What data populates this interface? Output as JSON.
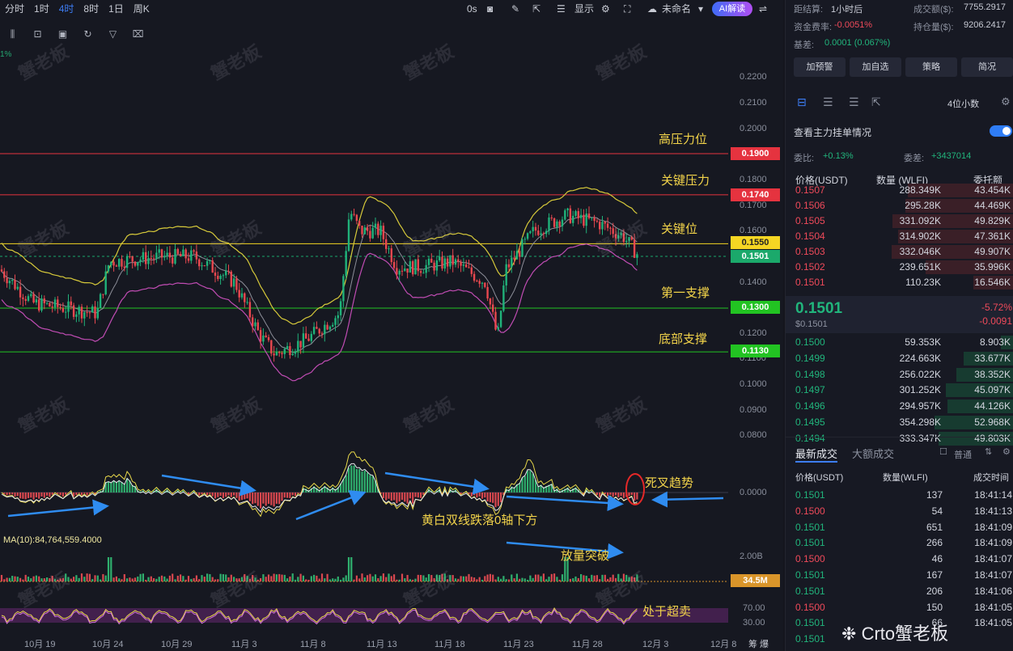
{
  "toolbar": {
    "timeframes": [
      "分时",
      "1时",
      "4时",
      "8时",
      "1日",
      "周K"
    ],
    "active_timeframe": "4时",
    "countdown": "0s",
    "display_label": "显示",
    "layout_name": "未命名",
    "ai_button": "AI解读"
  },
  "chart": {
    "change_hint": "1%",
    "y_axis_ticks": [
      "0.2200",
      "0.2100",
      "0.2000",
      "0.1800",
      "0.1700",
      "0.1600",
      "0.1400",
      "0.1200",
      "0.1100",
      "0.1000",
      "0.0900",
      "0.0800"
    ],
    "price_levels": [
      {
        "label": "高压力位",
        "price": "0.1900",
        "color": "#e5333f"
      },
      {
        "label": "关键压力",
        "price": "0.1740",
        "color": "#e5333f"
      },
      {
        "label": "关键位",
        "price": "0.1550",
        "color": "#f5d623"
      },
      {
        "label": "",
        "price": "0.1501",
        "color": "#1ba96b"
      },
      {
        "label": "第一支撑",
        "price": "0.1300",
        "color": "#22c322"
      },
      {
        "label": "底部支撑",
        "price": "0.1130",
        "color": "#22c322"
      }
    ],
    "macd_zero": "0.0000",
    "macd_annotations": [
      "死叉趋势",
      "黄白双线跌落0轴下方"
    ],
    "volume_ma_label": "MA(10):84,764,559.4000",
    "volume_axis": "2.00B",
    "volume_value": "34.5M",
    "volume_annotation": "放量突破",
    "rsi_annotation": "处于超卖",
    "rsi_levels": [
      "70.00",
      "30.00"
    ],
    "x_axis_dates": [
      "10月 19",
      "10月 24",
      "10月 29",
      "11月 3",
      "11月 8",
      "11月 13",
      "11月 18",
      "11月 23",
      "11月 28",
      "12月 3",
      "12月 8"
    ],
    "watermark": "蟹老板",
    "footer_text": "Cr",
    "footer_text2": "to蟹老板",
    "footer_small": "筹  爆"
  },
  "panel": {
    "settle_label": "距结算:",
    "settle_value": "1小时后",
    "turnover_label": "成交额($):",
    "turnover_value": "7755.2917",
    "funding_label": "资金费率:",
    "funding_value": "-0.0051%",
    "oi_label": "持仓量($):",
    "oi_value": "9206.2417",
    "basis_label": "基差:",
    "basis_value": "0.0001 (0.067%)",
    "buttons": [
      "加预警",
      "加自选",
      "策略",
      "简况"
    ],
    "decimals": "4位小数",
    "main_orders": "查看主力挂单情况",
    "ratio_label": "委比:",
    "ratio_value": "+0.13%",
    "diff_label": "委差:",
    "diff_value": "+3437014",
    "ob_headers": [
      "价格(USDT)",
      "数量 (WLFI)",
      "委托额"
    ],
    "asks": [
      {
        "price": "0.1507",
        "qty": "288.349K",
        "amount": "43.454K"
      },
      {
        "price": "0.1506",
        "qty": "295.28K",
        "amount": "44.469K"
      },
      {
        "price": "0.1505",
        "qty": "331.092K",
        "amount": "49.829K"
      },
      {
        "price": "0.1504",
        "qty": "314.902K",
        "amount": "47.361K"
      },
      {
        "price": "0.1503",
        "qty": "332.046K",
        "amount": "49.907K"
      },
      {
        "price": "0.1502",
        "qty": "239.651K",
        "amount": "35.996K"
      },
      {
        "price": "0.1501",
        "qty": "110.23K",
        "amount": "16.546K"
      }
    ],
    "last_price": "0.1501",
    "last_price_usd": "$0.1501",
    "change_pct": "-5.72%",
    "change_abs": "-0.0091",
    "bids": [
      {
        "price": "0.1500",
        "qty": "59.353K",
        "amount": "8.903K"
      },
      {
        "price": "0.1499",
        "qty": "224.663K",
        "amount": "33.677K"
      },
      {
        "price": "0.1498",
        "qty": "256.022K",
        "amount": "38.352K"
      },
      {
        "price": "0.1497",
        "qty": "301.252K",
        "amount": "45.097K"
      },
      {
        "price": "0.1496",
        "qty": "294.957K",
        "amount": "44.126K"
      },
      {
        "price": "0.1495",
        "qty": "354.298K",
        "amount": "52.968K"
      },
      {
        "price": "0.1494",
        "qty": "333.347K",
        "amount": "49.803K"
      }
    ],
    "trades_tab": "最新成交",
    "big_trades_tab": "大额成交",
    "normal_label": "普通",
    "trade_headers": [
      "价格(USDT)",
      "数量(WLFI)",
      "成交时间"
    ],
    "trades": [
      {
        "price": "0.1501",
        "qty": "137",
        "time": "18:41:14",
        "side": "buy"
      },
      {
        "price": "0.1500",
        "qty": "54",
        "time": "18:41:13",
        "side": "sell"
      },
      {
        "price": "0.1501",
        "qty": "651",
        "time": "18:41:09",
        "side": "buy"
      },
      {
        "price": "0.1501",
        "qty": "266",
        "time": "18:41:09",
        "side": "buy"
      },
      {
        "price": "0.1500",
        "qty": "46",
        "time": "18:41:07",
        "side": "sell"
      },
      {
        "price": "0.1501",
        "qty": "167",
        "time": "18:41:07",
        "side": "buy"
      },
      {
        "price": "0.1501",
        "qty": "206",
        "time": "18:41:06",
        "side": "buy"
      },
      {
        "price": "0.1500",
        "qty": "150",
        "time": "18:41:05",
        "side": "sell"
      },
      {
        "price": "0.1501",
        "qty": "66",
        "time": "18:41:05",
        "side": "buy"
      },
      {
        "price": "0.1501",
        "qty": "",
        "time": "",
        "side": "buy"
      }
    ]
  }
}
